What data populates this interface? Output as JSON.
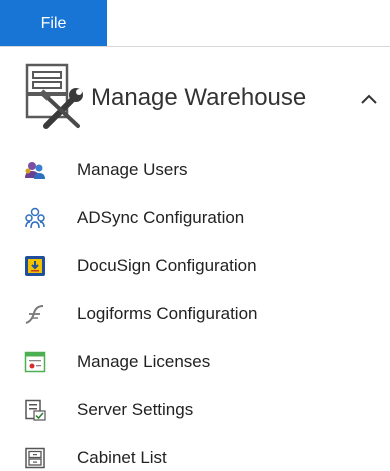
{
  "ribbon": {
    "file_label": "File"
  },
  "group": {
    "title": "Manage Warehouse",
    "icon": "warehouse-tools-icon",
    "collapse_icon": "chevron-up-icon"
  },
  "menu": {
    "items": [
      {
        "label": "Manage Users",
        "icon": "users-icon"
      },
      {
        "label": "ADSync Configuration",
        "icon": "adsync-users-icon"
      },
      {
        "label": "DocuSign Configuration",
        "icon": "docusign-icon"
      },
      {
        "label": "Logiforms Configuration",
        "icon": "logiforms-icon"
      },
      {
        "label": "Manage Licenses",
        "icon": "license-icon"
      },
      {
        "label": "Server Settings",
        "icon": "server-settings-icon"
      },
      {
        "label": "Cabinet List",
        "icon": "cabinet-icon"
      }
    ]
  },
  "colors": {
    "file_tab": "#1875d6",
    "text": "#222222"
  }
}
